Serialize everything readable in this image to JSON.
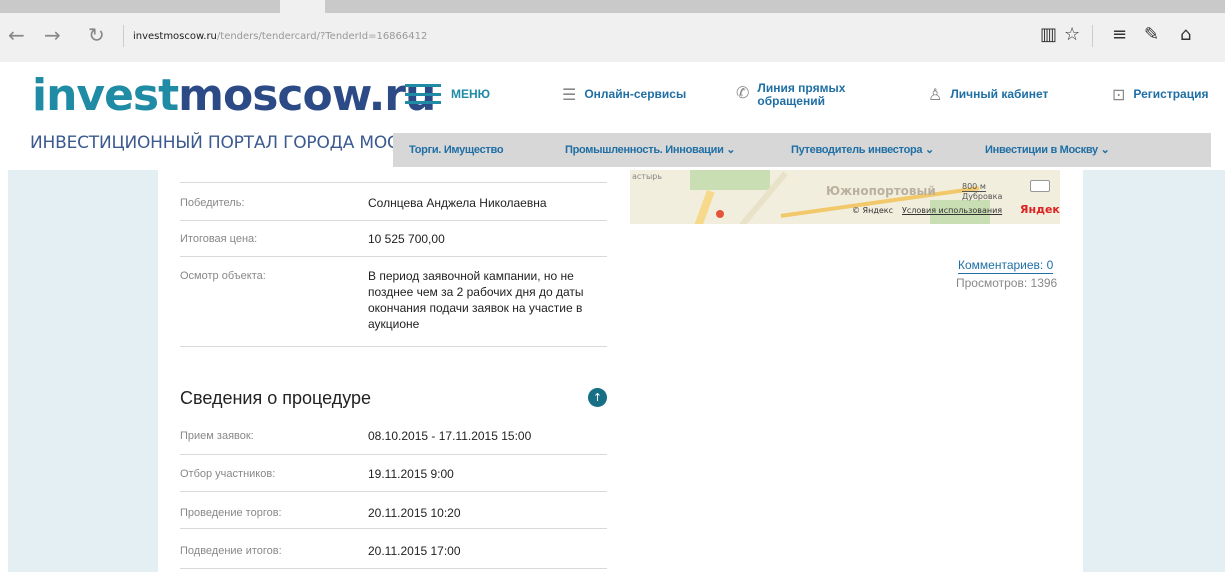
{
  "browser": {
    "url_host": "investmoscow.ru",
    "url_path": "/tenders/tendercard/?TenderId=16866412",
    "icons": [
      "back-icon",
      "forward-icon",
      "refresh-icon",
      "reading-view-icon",
      "favorite-star-icon",
      "hub-icon",
      "web-note-icon",
      "share-icon"
    ]
  },
  "header": {
    "logo_part1": "invest",
    "logo_part2": "moscow.ru",
    "tagline": "ИНВЕСТИЦИОННЫЙ ПОРТАЛ ГОРОДА МОСКВЫ",
    "menu_label": "МЕНЮ",
    "links": {
      "online": "Онлайн-сервисы",
      "hotline_1": "Линия прямых",
      "hotline_2": "обращений",
      "cabinet": "Личный кабинет",
      "register": "Регистрация"
    },
    "subnav": {
      "auctions": "Торги. Имущество",
      "industry": "Промышленность. Инновации ⌄",
      "guide": "Путеводитель инвестора ⌄",
      "invest": "Инвестиции в Москву ⌄"
    }
  },
  "details": {
    "winner_label": "Победитель:",
    "winner_value": "Солнцева Анджела Николаевна",
    "price_label": "Итоговая цена:",
    "price_value": "10 525 700,00",
    "inspect_label": "Осмотр объекта:",
    "inspect_value": "В период заявочной кампании, но не позднее чем за 2 рабочих дня до даты окончания подачи заявок на участие в аукционе"
  },
  "procedure": {
    "title": "Сведения о процедуре",
    "rows": [
      {
        "label": "Прием заявок:",
        "value": "08.10.2015 - 17.11.2015 15:00"
      },
      {
        "label": "Отбор участников:",
        "value": "19.11.2015 9:00"
      },
      {
        "label": "Проведение торгов:",
        "value": "20.11.2015 10:20"
      },
      {
        "label": "Подведение итогов:",
        "value": "20.11.2015 17:00"
      }
    ]
  },
  "map": {
    "district": "Южнопортовый",
    "place": "Дубровка",
    "scale": "800 м",
    "corner_label": "астырь",
    "copyright": "© Яндекс",
    "terms": "Условия использования",
    "brand": "Яндекс"
  },
  "stats": {
    "comments": "Комментариев: 0",
    "views": "Просмотров: 1396"
  }
}
